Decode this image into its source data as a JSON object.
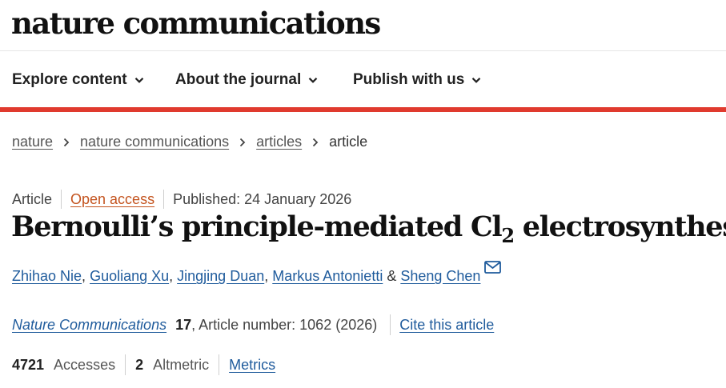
{
  "header": {
    "logo": "nature communications"
  },
  "nav": {
    "items": [
      {
        "label": "Explore content"
      },
      {
        "label": "About the journal"
      },
      {
        "label": "Publish with us"
      }
    ]
  },
  "breadcrumb": {
    "items": [
      "nature",
      "nature communications",
      "articles"
    ],
    "current": "article"
  },
  "article_meta": {
    "type": "Article",
    "access": "Open access",
    "published": "Published: 24 January 2026"
  },
  "title": {
    "before": "Bernoulli’s principle-mediated Cl",
    "subscript": "2",
    "after": " electrosynthesis"
  },
  "authors": {
    "list": [
      "Zhihao Nie",
      "Guoliang Xu",
      "Jingjing Duan",
      "Markus Antonietti",
      "Sheng Chen"
    ],
    "separator": ", ",
    "last_separator": " & "
  },
  "citation": {
    "journal": "Nature Communications",
    "volume": "17",
    "details": ", Article number: 1062 (2026)",
    "cite_link": "Cite this article"
  },
  "metrics": {
    "accesses_count": "4721",
    "accesses_label": "Accesses",
    "altmetric_count": "2",
    "altmetric_label": "Altmetric",
    "metrics_link": "Metrics"
  },
  "colors": {
    "accent_bar": "#e03a2e",
    "link": "#1f5b9c",
    "open_access": "#c4541f"
  },
  "icons": {
    "nav_dropdown": "chevron-down-icon",
    "breadcrumb_separator": "chevron-right-icon",
    "corresponding_author": "mail-icon"
  }
}
